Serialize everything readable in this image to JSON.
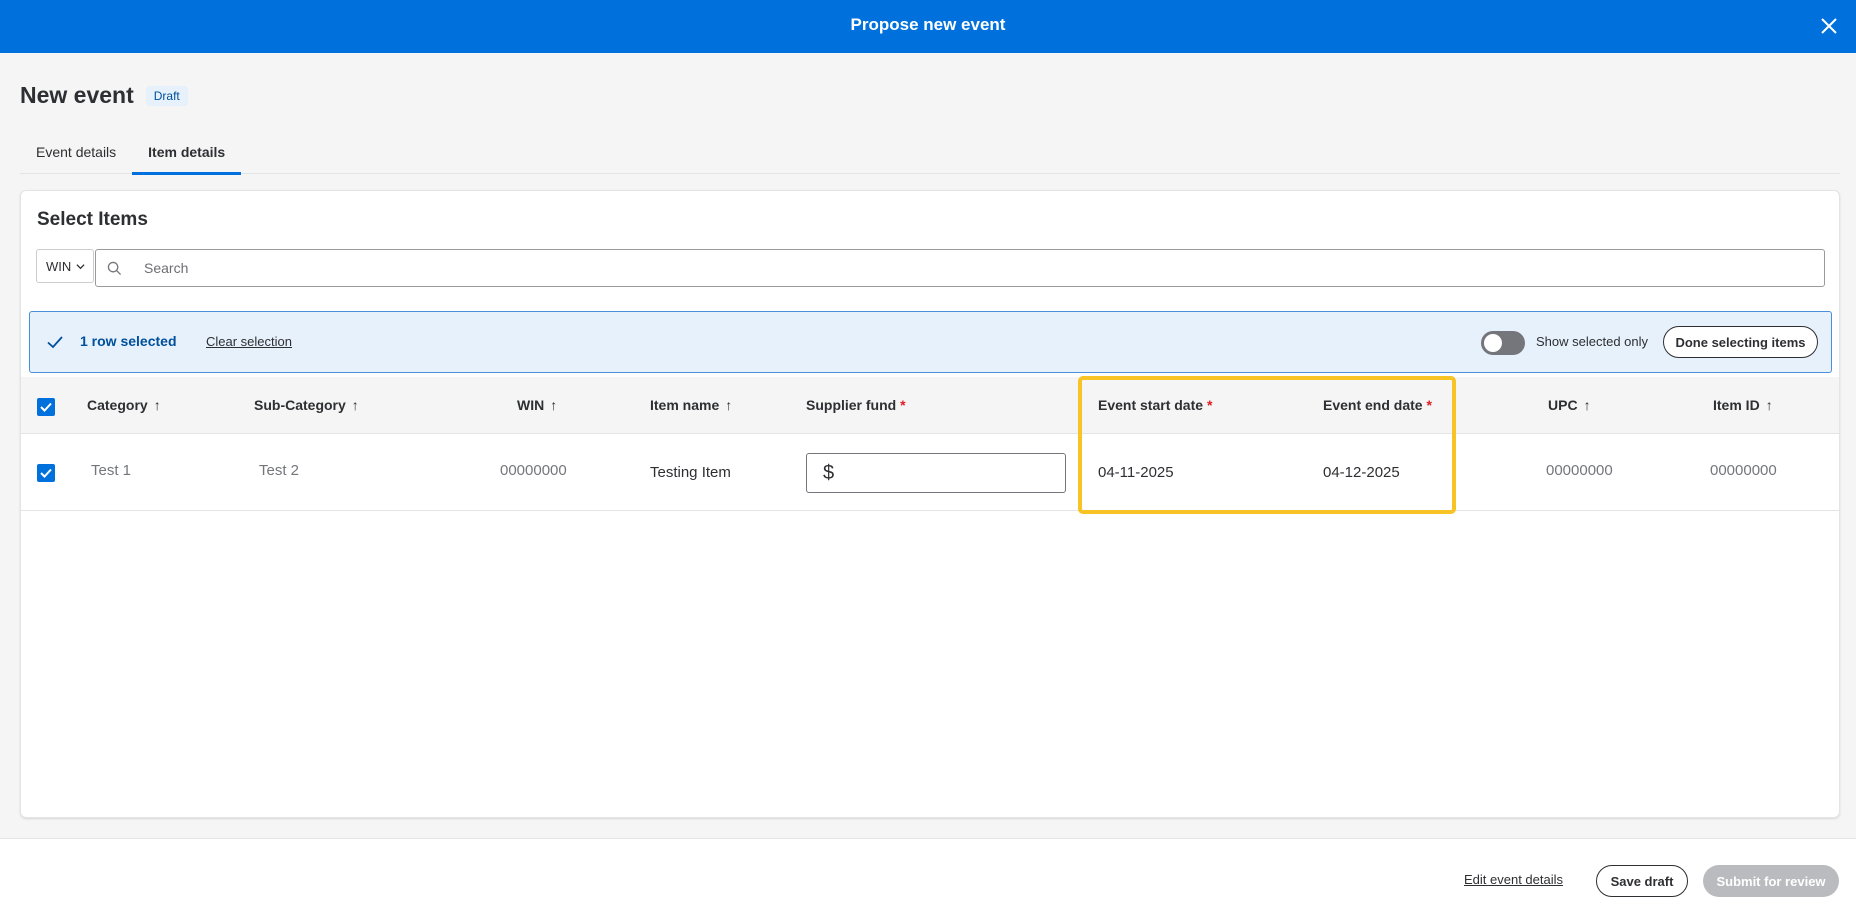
{
  "header": {
    "title": "Propose new event",
    "close_icon": "close-icon"
  },
  "page": {
    "title": "New event",
    "badge": "Draft"
  },
  "tabs": [
    {
      "label": "Event details",
      "active": false
    },
    {
      "label": "Item details",
      "active": true
    }
  ],
  "card": {
    "title": "Select Items",
    "id_type_select": {
      "value": "WIN"
    },
    "search": {
      "placeholder": "Search",
      "value": ""
    }
  },
  "selection_bar": {
    "count_text": "1 row selected",
    "clear_label": "Clear selection",
    "toggle_label": "Show selected only",
    "toggle_on": false,
    "done_label": "Done selecting items"
  },
  "table": {
    "columns": [
      {
        "label": "Category",
        "sort": "↑",
        "required": false
      },
      {
        "label": "Sub-Category",
        "sort": "↑",
        "required": false
      },
      {
        "label": "WIN",
        "sort": "↑",
        "required": false
      },
      {
        "label": "Item name",
        "sort": "↑",
        "required": false
      },
      {
        "label": "Supplier fund",
        "sort": "",
        "required": true
      },
      {
        "label": "Event start date",
        "sort": "",
        "required": true
      },
      {
        "label": "Event end date",
        "sort": "",
        "required": true
      },
      {
        "label": "UPC",
        "sort": "↑",
        "required": false
      },
      {
        "label": "Item ID",
        "sort": "↑",
        "required": false
      }
    ],
    "required_mark": "*",
    "rows": [
      {
        "selected": true,
        "category": "Test 1",
        "sub_category": "Test 2",
        "win": "00000000",
        "item_name": "Testing Item",
        "supplier_fund": {
          "prefix": "$",
          "value": ""
        },
        "event_start_date": "04-11-2025",
        "event_end_date": "04-12-2025",
        "upc": "00000000",
        "item_id": "00000000"
      }
    ]
  },
  "footer": {
    "edit_link": "Edit event details",
    "save_label": "Save draft",
    "submit_label": "Submit for review"
  },
  "colors": {
    "brand": "#0071dc",
    "highlight": "#f7c325",
    "required": "#de1c24",
    "selection_bg": "#e6f1fc"
  }
}
